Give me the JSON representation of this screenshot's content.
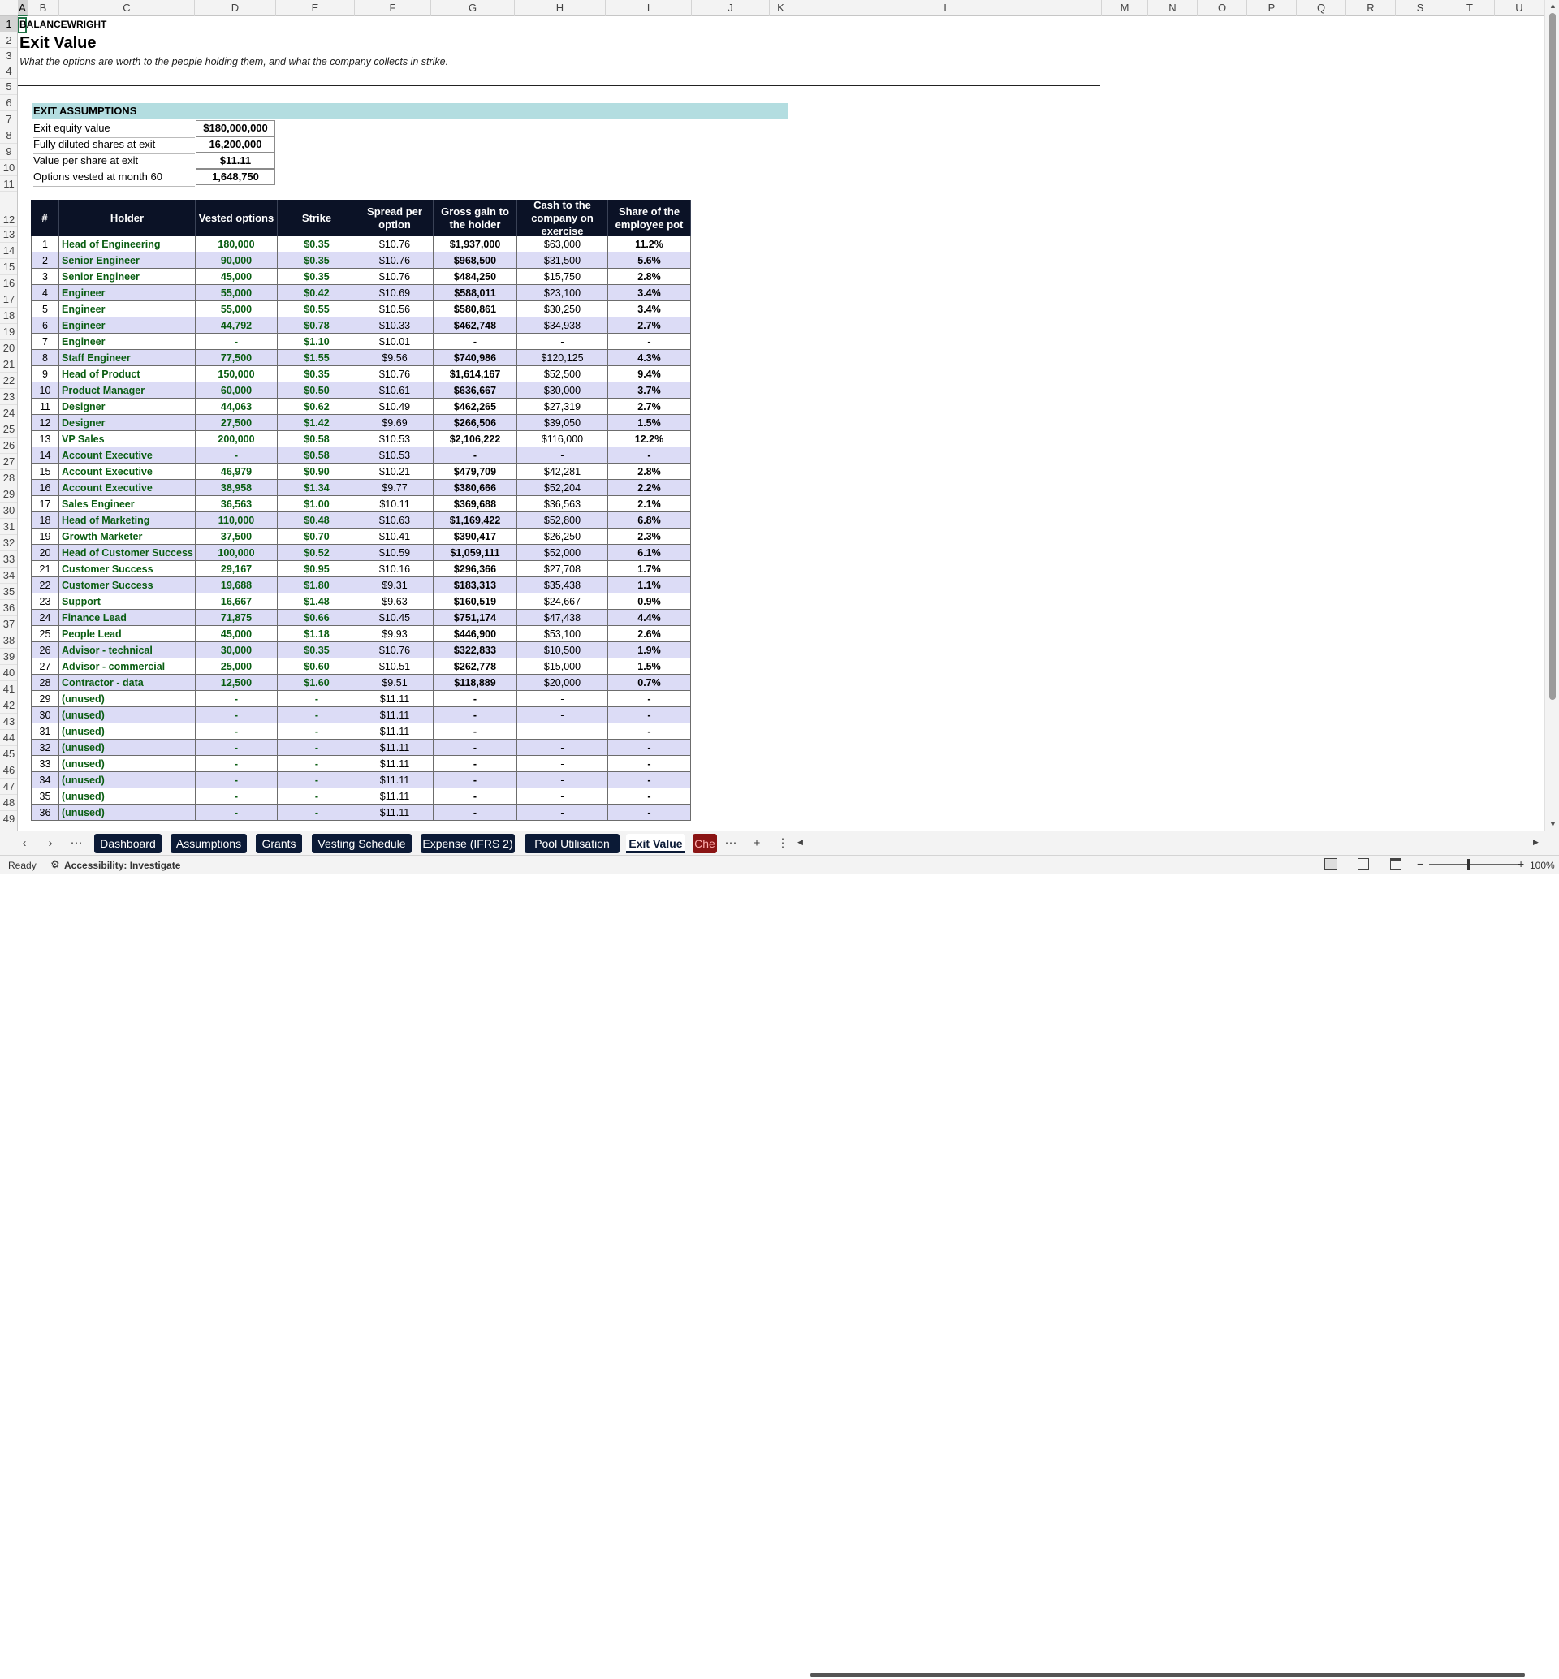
{
  "columns": [
    "A",
    "B",
    "C",
    "D",
    "E",
    "F",
    "G",
    "H",
    "I",
    "J",
    "K",
    "L",
    "M",
    "N",
    "O",
    "P",
    "Q",
    "R",
    "S",
    "T",
    "U"
  ],
  "sheet": {
    "company": "BALANCEWRIGHT",
    "title": "Exit Value",
    "subtitle": "What the options are worth to the people holding them, and what the company collects in strike.",
    "assumptions_header": "EXIT ASSUMPTIONS",
    "assumptions": [
      {
        "label": "Exit equity value",
        "value": "$180,000,000"
      },
      {
        "label": "Fully diluted shares at exit",
        "value": "16,200,000"
      },
      {
        "label": "Value per share at exit",
        "value": "$11.11"
      },
      {
        "label": "Options vested at month 60",
        "value": "1,648,750"
      }
    ],
    "table_headers": [
      "#",
      "Holder",
      "Vested options",
      "Strike",
      "Spread per option",
      "Gross gain to the holder",
      "Cash to the company on exercise",
      "Share of the employee pot"
    ],
    "rows": [
      [
        "1",
        "Head of Engineering",
        "180,000",
        "$0.35",
        "$10.76",
        "$1,937,000",
        "$63,000",
        "11.2%"
      ],
      [
        "2",
        "Senior Engineer",
        "90,000",
        "$0.35",
        "$10.76",
        "$968,500",
        "$31,500",
        "5.6%"
      ],
      [
        "3",
        "Senior Engineer",
        "45,000",
        "$0.35",
        "$10.76",
        "$484,250",
        "$15,750",
        "2.8%"
      ],
      [
        "4",
        "Engineer",
        "55,000",
        "$0.42",
        "$10.69",
        "$588,011",
        "$23,100",
        "3.4%"
      ],
      [
        "5",
        "Engineer",
        "55,000",
        "$0.55",
        "$10.56",
        "$580,861",
        "$30,250",
        "3.4%"
      ],
      [
        "6",
        "Engineer",
        "44,792",
        "$0.78",
        "$10.33",
        "$462,748",
        "$34,938",
        "2.7%"
      ],
      [
        "7",
        "Engineer",
        "-",
        "$1.10",
        "$10.01",
        "-",
        "-",
        "-"
      ],
      [
        "8",
        "Staff Engineer",
        "77,500",
        "$1.55",
        "$9.56",
        "$740,986",
        "$120,125",
        "4.3%"
      ],
      [
        "9",
        "Head of Product",
        "150,000",
        "$0.35",
        "$10.76",
        "$1,614,167",
        "$52,500",
        "9.4%"
      ],
      [
        "10",
        "Product Manager",
        "60,000",
        "$0.50",
        "$10.61",
        "$636,667",
        "$30,000",
        "3.7%"
      ],
      [
        "11",
        "Designer",
        "44,063",
        "$0.62",
        "$10.49",
        "$462,265",
        "$27,319",
        "2.7%"
      ],
      [
        "12",
        "Designer",
        "27,500",
        "$1.42",
        "$9.69",
        "$266,506",
        "$39,050",
        "1.5%"
      ],
      [
        "13",
        "VP Sales",
        "200,000",
        "$0.58",
        "$10.53",
        "$2,106,222",
        "$116,000",
        "12.2%"
      ],
      [
        "14",
        "Account Executive",
        "-",
        "$0.58",
        "$10.53",
        "-",
        "-",
        "-"
      ],
      [
        "15",
        "Account Executive",
        "46,979",
        "$0.90",
        "$10.21",
        "$479,709",
        "$42,281",
        "2.8%"
      ],
      [
        "16",
        "Account Executive",
        "38,958",
        "$1.34",
        "$9.77",
        "$380,666",
        "$52,204",
        "2.2%"
      ],
      [
        "17",
        "Sales Engineer",
        "36,563",
        "$1.00",
        "$10.11",
        "$369,688",
        "$36,563",
        "2.1%"
      ],
      [
        "18",
        "Head of Marketing",
        "110,000",
        "$0.48",
        "$10.63",
        "$1,169,422",
        "$52,800",
        "6.8%"
      ],
      [
        "19",
        "Growth Marketer",
        "37,500",
        "$0.70",
        "$10.41",
        "$390,417",
        "$26,250",
        "2.3%"
      ],
      [
        "20",
        "Head of Customer Success",
        "100,000",
        "$0.52",
        "$10.59",
        "$1,059,111",
        "$52,000",
        "6.1%"
      ],
      [
        "21",
        "Customer Success",
        "29,167",
        "$0.95",
        "$10.16",
        "$296,366",
        "$27,708",
        "1.7%"
      ],
      [
        "22",
        "Customer Success",
        "19,688",
        "$1.80",
        "$9.31",
        "$183,313",
        "$35,438",
        "1.1%"
      ],
      [
        "23",
        "Support",
        "16,667",
        "$1.48",
        "$9.63",
        "$160,519",
        "$24,667",
        "0.9%"
      ],
      [
        "24",
        "Finance Lead",
        "71,875",
        "$0.66",
        "$10.45",
        "$751,174",
        "$47,438",
        "4.4%"
      ],
      [
        "25",
        "People Lead",
        "45,000",
        "$1.18",
        "$9.93",
        "$446,900",
        "$53,100",
        "2.6%"
      ],
      [
        "26",
        "Advisor - technical",
        "30,000",
        "$0.35",
        "$10.76",
        "$322,833",
        "$10,500",
        "1.9%"
      ],
      [
        "27",
        "Advisor - commercial",
        "25,000",
        "$0.60",
        "$10.51",
        "$262,778",
        "$15,000",
        "1.5%"
      ],
      [
        "28",
        "Contractor - data",
        "12,500",
        "$1.60",
        "$9.51",
        "$118,889",
        "$20,000",
        "0.7%"
      ],
      [
        "29",
        "(unused)",
        "-",
        "-",
        "$11.11",
        "-",
        "-",
        "-"
      ],
      [
        "30",
        "(unused)",
        "-",
        "-",
        "$11.11",
        "-",
        "-",
        "-"
      ],
      [
        "31",
        "(unused)",
        "-",
        "-",
        "$11.11",
        "-",
        "-",
        "-"
      ],
      [
        "32",
        "(unused)",
        "-",
        "-",
        "$11.11",
        "-",
        "-",
        "-"
      ],
      [
        "33",
        "(unused)",
        "-",
        "-",
        "$11.11",
        "-",
        "-",
        "-"
      ],
      [
        "34",
        "(unused)",
        "-",
        "-",
        "$11.11",
        "-",
        "-",
        "-"
      ],
      [
        "35",
        "(unused)",
        "-",
        "-",
        "$11.11",
        "-",
        "-",
        "-"
      ],
      [
        "36",
        "(unused)",
        "-",
        "-",
        "$11.11",
        "-",
        "-",
        "-"
      ]
    ]
  },
  "tabs": [
    "Dashboard",
    "Assumptions",
    "Grants",
    "Vesting Schedule",
    "Expense (IFRS 2)",
    "Pool Utilisation",
    "Exit Value",
    "Che"
  ],
  "active_tab": "Exit Value",
  "status": {
    "ready": "Ready",
    "accessibility": "Accessibility: Investigate",
    "zoom": "100%"
  },
  "colors": {
    "header_bg": "#0b1226",
    "assumption_band": "#b3dde0",
    "alt_row": "#dcdcf6",
    "holder_text": "#0a5d12",
    "tab_bg": "#0b1a36"
  }
}
